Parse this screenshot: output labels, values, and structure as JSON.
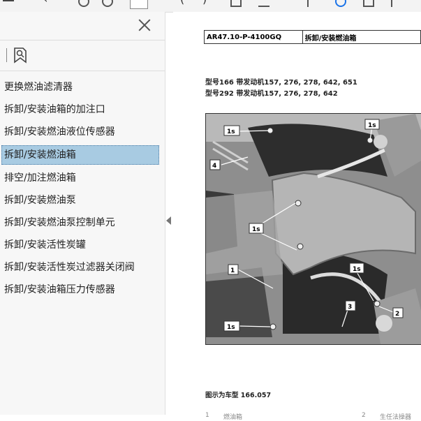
{
  "sidebar": {
    "bookmarks": [
      "更换燃油滤清器",
      "拆卸/安装油箱的加注口",
      "拆卸/安装燃油液位传感器",
      "拆卸/安装燃油箱",
      "排空/加注燃油箱",
      "拆卸/安装燃油泵",
      "拆卸/安装燃油泵控制单元",
      "拆卸/安装活性炭罐",
      "拆卸/安装活性炭过滤器关闭阀",
      "拆卸/安装油箱压力传感器"
    ],
    "selected_index": 3
  },
  "document": {
    "doc_code": "AR47.10-P-4100GQ",
    "doc_title": "拆卸/安装燃油箱",
    "model_line1": "型号166 带发动机157, 276, 278, 642, 651",
    "model_line2": "型号292 带发动机157, 276, 278, 642",
    "callouts": [
      "1s",
      "1s",
      "4",
      "1s",
      "1s",
      "1",
      "1s",
      "3",
      "2",
      "1s"
    ],
    "caption": "图示为车型 166.057",
    "footer_left_num": "1",
    "footer_left_text": "燃油箱",
    "footer_right_num": "2",
    "footer_right_text": "生任法操器"
  },
  "colors": {
    "selection": "#a8cbe2",
    "sidebar_bg": "#f7f7f7",
    "accent": "#1a73e8"
  }
}
